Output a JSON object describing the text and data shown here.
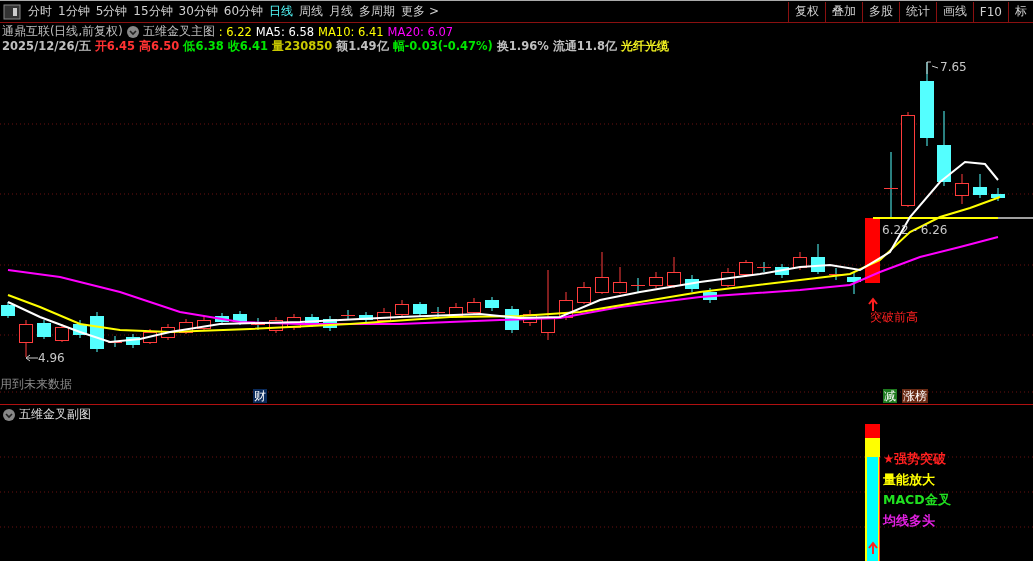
{
  "toolbar": {
    "periods": [
      {
        "label": "分时",
        "selected": false
      },
      {
        "label": "1分钟",
        "selected": false
      },
      {
        "label": "5分钟",
        "selected": false
      },
      {
        "label": "15分钟",
        "selected": false
      },
      {
        "label": "30分钟",
        "selected": false
      },
      {
        "label": "60分钟",
        "selected": false
      },
      {
        "label": "日线",
        "selected": true
      },
      {
        "label": "周线",
        "selected": false
      },
      {
        "label": "月线",
        "selected": false
      },
      {
        "label": "多周期",
        "selected": false
      },
      {
        "label": "更多 >",
        "selected": false
      }
    ],
    "tools": [
      "复权",
      "叠加",
      "多股",
      "统计",
      "画线",
      "F10",
      "标"
    ]
  },
  "header": {
    "stock": "通鼎互联(日线,前复权)",
    "indicator": "五维金叉主图",
    "values": [
      {
        "text": " : 6.22",
        "color": "#ffff00"
      },
      {
        "text": "MA5: 6.58",
        "color": "#ffffff"
      },
      {
        "text": "MA10: 6.41",
        "color": "#ffff00"
      },
      {
        "text": "MA20: 6.07",
        "color": "#ff00ff"
      }
    ]
  },
  "quote": [
    {
      "text": "2025/12/26/五",
      "color": "#c0c0c0"
    },
    {
      "text": "开6.45",
      "color": "#ff3232"
    },
    {
      "text": "高6.50",
      "color": "#ff3232"
    },
    {
      "text": "低6.38",
      "color": "#00e600"
    },
    {
      "text": "收6.41",
      "color": "#00e600"
    },
    {
      "text": "量230850",
      "color": "#c8c800"
    },
    {
      "text": "额1.49亿",
      "color": "#c0c0c0"
    },
    {
      "text": "幅-0.03(-0.47%)",
      "color": "#00e600"
    },
    {
      "text": "换1.96%",
      "color": "#c0c0c0"
    },
    {
      "text": "流通11.8亿",
      "color": "#c0c0c0"
    },
    {
      "text": "光纤光缆",
      "color": "#f0f020"
    }
  ],
  "main_chart": {
    "high_label": "7.65",
    "low_label": "4.96",
    "range_label": "6.22 - 6.26",
    "signal": "突破前高",
    "warning": "用到未来数据",
    "badges": [
      {
        "text": "财",
        "color": "#0a2a5a"
      },
      {
        "text": "减",
        "color": "#1e7a1e"
      },
      {
        "text": "涨榜",
        "color": "#6a2a14"
      }
    ]
  },
  "sub_chart": {
    "title": "五维金叉副图",
    "signals": [
      {
        "text": "★强势突破",
        "color": "#ff2020"
      },
      {
        "text": "量能放大",
        "color": "#ffff00"
      },
      {
        "text": "MACD金叉",
        "color": "#20e020"
      },
      {
        "text": "均线多头",
        "color": "#e020e0"
      }
    ]
  }
}
